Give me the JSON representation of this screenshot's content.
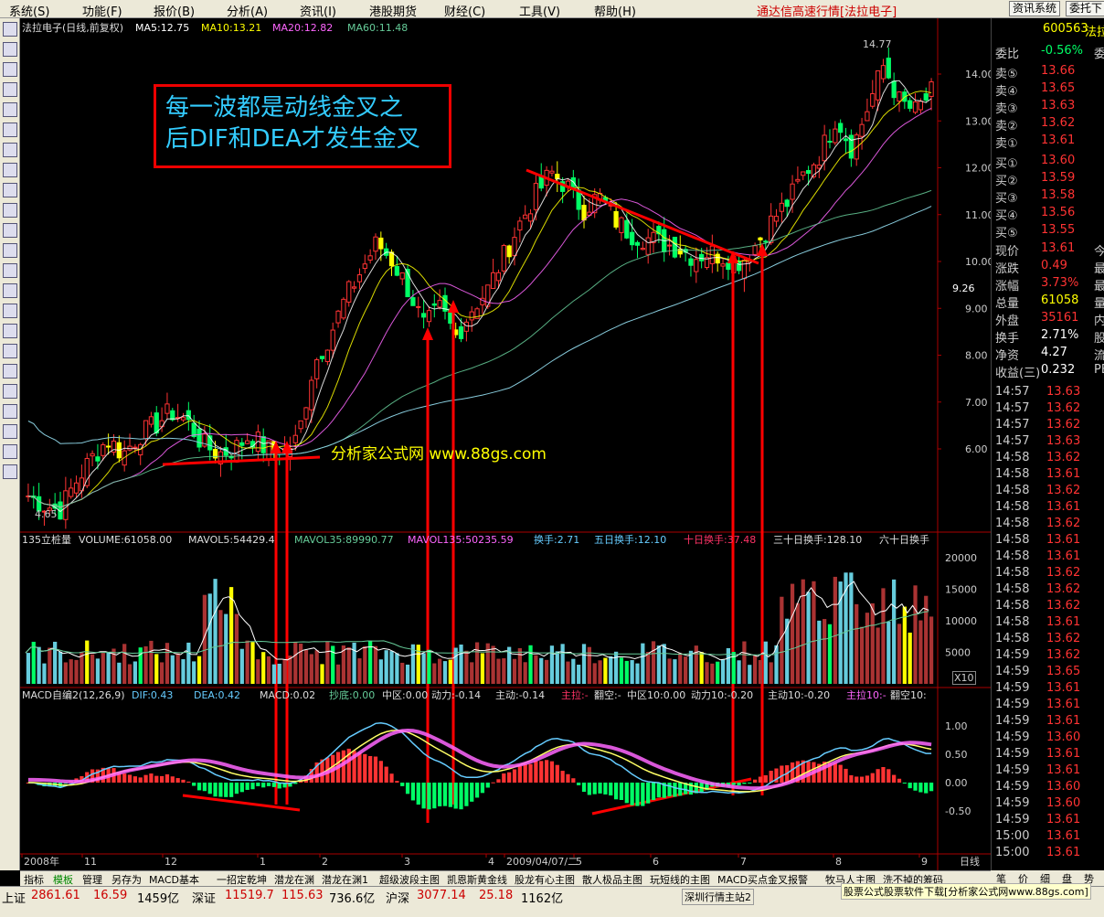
{
  "menubar": {
    "items": [
      "系统(S)",
      "功能(F)",
      "报价(B)",
      "分析(A)",
      "资讯(I)",
      "港股期货",
      "财经(C)",
      "工具(V)",
      "帮助(H)"
    ],
    "title": "通达信高速行情[法拉电子]",
    "btn_info": "资讯系统",
    "btn_delegate": "委托下"
  },
  "main": {
    "header": {
      "name": "法拉电子(日线,前复权)",
      "ma5": "MA5:12.75",
      "ma10": "MA10:13.21",
      "ma20": "MA20:12.82",
      "ma60": "MA60:11.48"
    },
    "annotation": {
      "line1": "每一波都是动线金叉之",
      "line2": "后DIF和DEA才发生金叉"
    },
    "watermark": "分析家公式网 www.88gs.com",
    "high_label": "14.77",
    "low_label": "4.65",
    "price_axis": [
      "14.00",
      "13.00",
      "12.00",
      "11.00",
      "10.00",
      "9.00",
      "8.00",
      "7.00",
      "6.00"
    ],
    "current_price_tag": "9.26",
    "colors": {
      "up": "#ff3333",
      "down": "#00ff66",
      "ma5": "#ffffff",
      "ma10": "#ffff00",
      "ma20": "#ff66ff",
      "ma60": "#66cc99",
      "annotation": "#ff0000"
    }
  },
  "volume": {
    "header": {
      "name": "135立桩量",
      "volume": "VOLUME:61058.00",
      "mavol5": "MAVOL5:54429.4",
      "mavol35": "MAVOL35:89990.77",
      "mavol135": "MAVOL135:50235.59",
      "turnover": "换手:2.71",
      "turnover5": "五日换手:12.10",
      "turnover10": "十日换手:37.48",
      "turnover30": "三十日换手:128.10",
      "turnover60": "六十日换手"
    },
    "axis": [
      "20000",
      "15000",
      "10000",
      "5000"
    ],
    "unit": "X10"
  },
  "macd": {
    "header": {
      "name": "MACD自编2(12,26,9)",
      "dif": "DIF:0.43",
      "dea": "DEA:0.42",
      "macd": "MACD:0.02",
      "chaodi": "抄底:0.00",
      "zhongqu": "中区:0.00",
      "dongli": "动力:-0.14",
      "zhudong": "主动:-0.14",
      "zhula": "主拉:-",
      "fankong": "翻空:-",
      "zhongqu10": "中区10:0.00",
      "dongli10": "动力10:-0.20",
      "zhudong10": "主动10:-0.20",
      "zhula10": "主拉10:-",
      "fankong10": "翻空10:"
    },
    "axis": [
      "1.00",
      "0.50",
      "0.00",
      "-0.50"
    ]
  },
  "timeaxis": {
    "labels": [
      "2008年",
      "11",
      "12",
      "1",
      "2",
      "3",
      "4",
      "2009/04/07/二",
      "5",
      "6",
      "7",
      "8",
      "9"
    ],
    "period": "日线"
  },
  "quote": {
    "code": "600563",
    "name": "法拉",
    "weibi_label": "委比",
    "weibi": "-0.56%",
    "weicha": "委",
    "asks": [
      {
        "label": "卖⑤",
        "price": "13.66"
      },
      {
        "label": "卖④",
        "price": "13.65"
      },
      {
        "label": "卖③",
        "price": "13.63"
      },
      {
        "label": "卖②",
        "price": "13.62"
      },
      {
        "label": "卖①",
        "price": "13.61"
      }
    ],
    "bids": [
      {
        "label": "买①",
        "price": "13.60"
      },
      {
        "label": "买②",
        "price": "13.59"
      },
      {
        "label": "买③",
        "price": "13.58"
      },
      {
        "label": "买④",
        "price": "13.56"
      },
      {
        "label": "买⑤",
        "price": "13.55"
      }
    ],
    "stats": [
      {
        "label": "现价",
        "value": "13.61",
        "extra": "今",
        "color": "#ff3333"
      },
      {
        "label": "涨跌",
        "value": "0.49",
        "extra": "最",
        "color": "#ff3333"
      },
      {
        "label": "涨幅",
        "value": "3.73%",
        "extra": "最",
        "color": "#ff3333"
      },
      {
        "label": "总量",
        "value": "61058",
        "extra": "量",
        "color": "#ffff00"
      },
      {
        "label": "外盘",
        "value": "35161",
        "extra": "内",
        "color": "#ff3333"
      },
      {
        "label": "换手",
        "value": "2.71%",
        "extra": "股",
        "color": "#ffffff"
      },
      {
        "label": "净资",
        "value": "4.27",
        "extra": "流",
        "color": "#ffffff"
      },
      {
        "label": "收益(三)",
        "value": "0.232",
        "extra": "PE",
        "color": "#ffffff"
      }
    ],
    "ticks": [
      {
        "t": "14:57",
        "p": "13.63"
      },
      {
        "t": "14:57",
        "p": "13.62"
      },
      {
        "t": "14:57",
        "p": "13.62"
      },
      {
        "t": "14:57",
        "p": "13.63"
      },
      {
        "t": "14:58",
        "p": "13.62"
      },
      {
        "t": "14:58",
        "p": "13.61"
      },
      {
        "t": "14:58",
        "p": "13.62"
      },
      {
        "t": "14:58",
        "p": "13.61"
      },
      {
        "t": "14:58",
        "p": "13.62"
      },
      {
        "t": "14:58",
        "p": "13.61"
      },
      {
        "t": "14:58",
        "p": "13.61"
      },
      {
        "t": "14:58",
        "p": "13.62"
      },
      {
        "t": "14:58",
        "p": "13.62"
      },
      {
        "t": "14:58",
        "p": "13.62"
      },
      {
        "t": "14:58",
        "p": "13.61"
      },
      {
        "t": "14:58",
        "p": "13.62"
      },
      {
        "t": "14:59",
        "p": "13.62"
      },
      {
        "t": "14:59",
        "p": "13.65"
      },
      {
        "t": "14:59",
        "p": "13.61"
      },
      {
        "t": "14:59",
        "p": "13.61"
      },
      {
        "t": "14:59",
        "p": "13.61"
      },
      {
        "t": "14:59",
        "p": "13.60"
      },
      {
        "t": "14:59",
        "p": "13.61"
      },
      {
        "t": "14:59",
        "p": "13.61"
      },
      {
        "t": "14:59",
        "p": "13.60"
      },
      {
        "t": "14:59",
        "p": "13.60"
      },
      {
        "t": "14:59",
        "p": "13.61"
      },
      {
        "t": "15:00",
        "p": "13.61"
      },
      {
        "t": "15:00",
        "p": "13.61"
      }
    ]
  },
  "tabs": [
    "指标",
    "模板",
    "管理",
    "另存为",
    "MACD基本",
    "一招定乾坤",
    "潜龙在渊",
    "潜龙在渊1",
    "超级波段主图",
    "凯恩斯黄金线",
    "股龙有心主图",
    "散人极品主图",
    "玩短线的主图",
    "MACD买点金叉报警",
    "牧马人主图",
    "洗不掉的筹码"
  ],
  "right_tabs": [
    "笔",
    "价",
    "细",
    "盘",
    "势"
  ],
  "statusbar": {
    "sh_label": "上证",
    "sh_val": "2861.61",
    "sh_chg": "16.59",
    "sh_amt": "1459亿",
    "sz_label": "深证",
    "sz_val": "11519.7",
    "sz_chg": "115.63",
    "sz_amt": "736.6亿",
    "hs_label": "沪深",
    "hs_val": "3077.14",
    "hs_chg": "25.18",
    "hs_amt": "1162亿",
    "server": "深圳行情主站2",
    "footer": "股票公式股票软件下载[分析家公式网www.88gs.com]"
  },
  "chart_data": {
    "type": "candlestick",
    "price_axis": {
      "min": 5.5,
      "max": 14.9,
      "ticks": [
        6,
        7,
        8,
        9,
        10,
        11,
        12,
        13,
        14
      ]
    },
    "close_path": [
      5.0,
      4.8,
      4.7,
      5.3,
      5.8,
      6.2,
      5.9,
      6.3,
      6.5,
      6.8,
      6.6,
      6.1,
      5.9,
      6.0,
      6.3,
      6.0,
      5.9,
      6.2,
      7.8,
      8.4,
      9.2,
      9.8,
      10.4,
      10.0,
      9.4,
      8.6,
      9.0,
      8.4,
      9.0,
      9.4,
      10.1,
      10.8,
      11.4,
      11.9,
      11.6,
      11.1,
      11.4,
      10.9,
      10.6,
      10.5,
      10.4,
      10.3,
      10.1,
      10.2,
      10.1,
      10.0,
      10.4,
      10.9,
      11.3,
      11.9,
      12.3,
      13.1,
      12.4,
      13.3,
      14.2,
      13.4,
      13.2,
      13.6
    ],
    "macd_axis": {
      "min": -1.3,
      "max": 1.5,
      "ticks": [
        1.0,
        0.5,
        0.0,
        -0.5
      ]
    },
    "volume_axis": {
      "min": 0,
      "max": 22000,
      "ticks": [
        5000,
        10000,
        15000,
        20000
      ]
    }
  }
}
